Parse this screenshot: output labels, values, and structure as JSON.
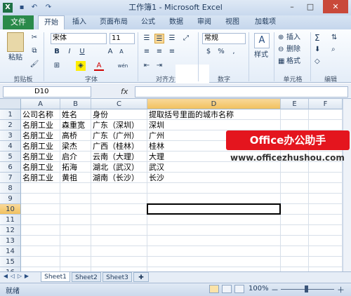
{
  "window": {
    "title": "工作簿1 - Microsoft Excel",
    "min": "–",
    "max": "□",
    "close": "✕"
  },
  "qat": {
    "save_icon": "save-icon",
    "undo_icon": "undo-icon",
    "redo_icon": "redo-icon"
  },
  "tabs": [
    {
      "label": "文件"
    },
    {
      "label": "开始"
    },
    {
      "label": "插入"
    },
    {
      "label": "页面布局"
    },
    {
      "label": "公式"
    },
    {
      "label": "数据"
    },
    {
      "label": "审阅"
    },
    {
      "label": "视图"
    },
    {
      "label": "加载项"
    }
  ],
  "ribbon": {
    "paste": "粘贴",
    "font_name": "宋体",
    "font_size": "11",
    "bold": "B",
    "italic": "I",
    "underline": "U",
    "grow_font": "A",
    "shrink_font": "A",
    "font_color": "A",
    "wen": "wén",
    "number_format": "常规",
    "percent": "%",
    "comma": ",",
    "currency": "$",
    "style": "样式",
    "insert": "插入",
    "delete": "删除",
    "format": "格式",
    "sigma": "Σ",
    "groups": {
      "clipboard": "剪贴板",
      "font": "字体",
      "align": "对齐方式",
      "number": "数字",
      "cells": "单元格",
      "edit": "编辑"
    }
  },
  "formula_bar": {
    "name_box": "D10",
    "fx": "fx",
    "content": ""
  },
  "sheet": {
    "columns": [
      "A",
      "B",
      "C",
      "D",
      "E",
      "F"
    ],
    "rows": [
      "1",
      "2",
      "3",
      "4",
      "5",
      "6",
      "7",
      "8",
      "9",
      "10",
      "11",
      "12",
      "13",
      "14",
      "15",
      "16"
    ],
    "selected_cell": "D10",
    "cells": [
      [
        "公司名称",
        "姓名",
        "身份",
        "提取括号里面的城市名称"
      ],
      [
        "名朋工业",
        "森重宽",
        "广东（深圳）",
        "深圳"
      ],
      [
        "名朋工业",
        "高桥",
        "广东（广州）",
        "广州"
      ],
      [
        "名朋工业",
        "梁杰",
        "广西（桂林）",
        "桂林"
      ],
      [
        "名朋工业",
        "启介",
        "云南（大理）",
        "大理"
      ],
      [
        "名朋工业",
        "拓海",
        "湖北（武汉）",
        "武汉"
      ],
      [
        "名朋工业",
        "黄祖",
        "湖南（长沙）",
        "长沙"
      ]
    ]
  },
  "sheet_tabs": [
    "Sheet1",
    "Sheet2",
    "Sheet3"
  ],
  "status": {
    "ready": "就绪",
    "zoom": "100%",
    "minus": "－",
    "plus": "＋"
  },
  "watermark": {
    "brand": "Office办公助手",
    "url": "www.officezhushou.com"
  }
}
